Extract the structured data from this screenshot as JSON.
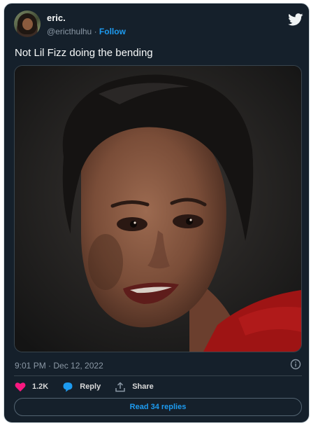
{
  "user": {
    "display_name": "eric.",
    "handle": "@ericthulhu",
    "separator": "·",
    "follow_label": "Follow"
  },
  "tweet": {
    "text": "Not Lil Fizz doing the bending",
    "timestamp": "9:01 PM · Dec 12, 2022"
  },
  "actions": {
    "like_count": "1.2K",
    "reply_label": "Reply",
    "share_label": "Share"
  },
  "read_replies_label": "Read 34 replies",
  "icons": {
    "logo": "twitter-bird-icon",
    "info": "info-icon",
    "like": "heart-icon",
    "reply": "speech-bubble-icon",
    "share": "share-icon"
  },
  "colors": {
    "background": "#15202b",
    "accent": "#1d9bf0",
    "like": "#f91880",
    "text": "#f7f9f9",
    "muted": "#8b98a5"
  }
}
